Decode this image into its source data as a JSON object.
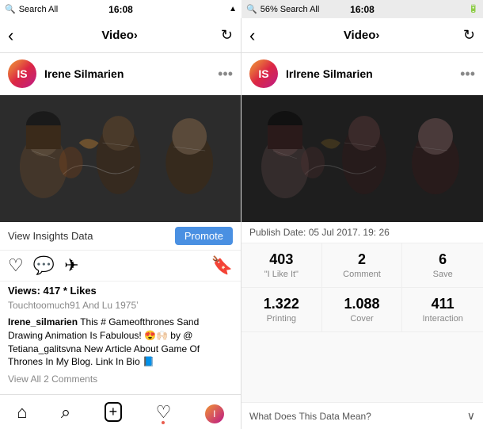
{
  "app": {
    "title": "Search AI",
    "status_left": "Search All",
    "status_right": "56% Search All",
    "time_left": "16:08",
    "time_right": "16:08",
    "battery": "56%"
  },
  "left_panel": {
    "nav_title": "Video",
    "nav_title_arrow": "›",
    "profile_name": "Irene Silmarien",
    "insights_text": "View Insights Data",
    "promote_label": "Promote",
    "views_likes": "Views: 417 * Likes",
    "tagged_users": "Touchtoomuch91 And Lu  1975ʼ",
    "caption_username": "Irene_silmarien",
    "caption_text": " This # Gameofthrones Sand Drawing Animation Is Fabulous! 😍🙌🏻 by @ Tetiana_galitsvna New Article About Game Of Thrones In My Blog. Link In Bio 📘",
    "view_comments": "View All 2 Comments",
    "bottom_nav": {
      "home": "⌂",
      "search": "🔍",
      "add": "+",
      "heart": "♡",
      "profile": "👤"
    }
  },
  "right_panel": {
    "nav_title": "Video",
    "nav_title_arrow": "›",
    "profile_name": "IrIrene Silmarien",
    "publish_label": "Publish Date: 05 Jul 2017. 19: 26",
    "stats": [
      {
        "value": "403",
        "label": "\"I Like It\""
      },
      {
        "value": "2",
        "label": "Comment"
      },
      {
        "value": "6",
        "label": "Save"
      },
      {
        "value": "1.322",
        "label": "Printing"
      },
      {
        "value": "1.088",
        "label": "Cover"
      },
      {
        "value": "411",
        "label": "Interaction"
      }
    ],
    "bottom_text": "What Does This Data Mean?",
    "bottom_arrow": "∨"
  }
}
